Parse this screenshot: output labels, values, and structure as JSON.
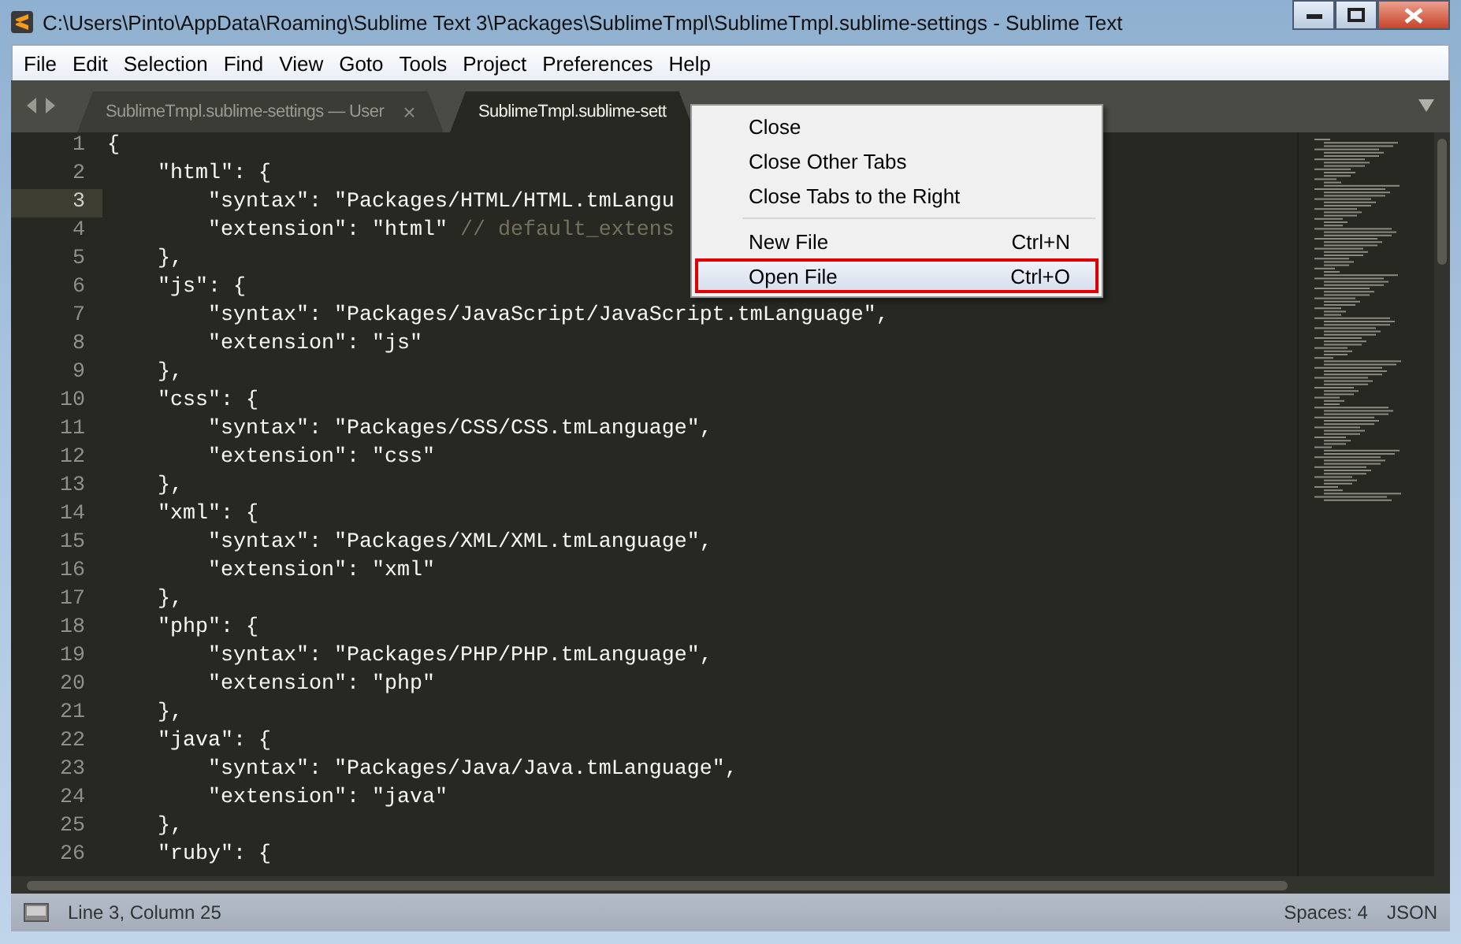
{
  "window": {
    "title": "C:\\Users\\Pinto\\AppData\\Roaming\\Sublime Text 3\\Packages\\SublimeTmpl\\SublimeTmpl.sublime-settings - Sublime Text"
  },
  "menu_bar": [
    "File",
    "Edit",
    "Selection",
    "Find",
    "View",
    "Goto",
    "Tools",
    "Project",
    "Preferences",
    "Help"
  ],
  "tabs": [
    {
      "label": "SublimeTmpl.sublime-settings — User",
      "selected": false,
      "close": "×"
    },
    {
      "label": "SublimeTmpl.sublime-sett",
      "selected": true
    }
  ],
  "editor": {
    "lines": [
      {
        "number": "1",
        "code": "{",
        "current": false
      },
      {
        "number": "2",
        "code": "    \"html\": {",
        "current": false
      },
      {
        "number": "3",
        "code": "        \"syntax\": \"Packages/HTML/HTML.tmLangu",
        "current": true
      },
      {
        "number": "4",
        "code": "        \"extension\": \"html\" ",
        "comment": "// default_extens",
        "current": false
      },
      {
        "number": "5",
        "code": "    },",
        "current": false
      },
      {
        "number": "6",
        "code": "    \"js\": {",
        "current": false
      },
      {
        "number": "7",
        "code": "        \"syntax\": \"Packages/JavaScript/JavaScript.tmLanguage\",",
        "current": false
      },
      {
        "number": "8",
        "code": "        \"extension\": \"js\"",
        "current": false
      },
      {
        "number": "9",
        "code": "    },",
        "current": false
      },
      {
        "number": "10",
        "code": "    \"css\": {",
        "current": false
      },
      {
        "number": "11",
        "code": "        \"syntax\": \"Packages/CSS/CSS.tmLanguage\",",
        "current": false
      },
      {
        "number": "12",
        "code": "        \"extension\": \"css\"",
        "current": false
      },
      {
        "number": "13",
        "code": "    },",
        "current": false
      },
      {
        "number": "14",
        "code": "    \"xml\": {",
        "current": false
      },
      {
        "number": "15",
        "code": "        \"syntax\": \"Packages/XML/XML.tmLanguage\",",
        "current": false
      },
      {
        "number": "16",
        "code": "        \"extension\": \"xml\"",
        "current": false
      },
      {
        "number": "17",
        "code": "    },",
        "current": false
      },
      {
        "number": "18",
        "code": "    \"php\": {",
        "current": false
      },
      {
        "number": "19",
        "code": "        \"syntax\": \"Packages/PHP/PHP.tmLanguage\",",
        "current": false
      },
      {
        "number": "20",
        "code": "        \"extension\": \"php\"",
        "current": false
      },
      {
        "number": "21",
        "code": "    },",
        "current": false
      },
      {
        "number": "22",
        "code": "    \"java\": {",
        "current": false
      },
      {
        "number": "23",
        "code": "        \"syntax\": \"Packages/Java/Java.tmLanguage\",",
        "current": false
      },
      {
        "number": "24",
        "code": "        \"extension\": \"java\"",
        "current": false
      },
      {
        "number": "25",
        "code": "    },",
        "current": false
      },
      {
        "number": "26",
        "code": "    \"ruby\": {",
        "current": false
      }
    ]
  },
  "context_menu": [
    {
      "kind": "item",
      "label": "Close",
      "selected": false
    },
    {
      "kind": "item",
      "label": "Close Other Tabs",
      "selected": false
    },
    {
      "kind": "item",
      "label": "Close Tabs to the Right",
      "selected": false
    },
    {
      "kind": "separator"
    },
    {
      "kind": "item",
      "label": "New File",
      "shortcut": "Ctrl+N",
      "selected": false
    },
    {
      "kind": "item",
      "label": "Open File",
      "shortcut": "Ctrl+O",
      "selected": true
    }
  ],
  "status_bar": {
    "position": "Line 3, Column 25",
    "indentation": "Spaces: 4",
    "syntax": "JSON"
  }
}
